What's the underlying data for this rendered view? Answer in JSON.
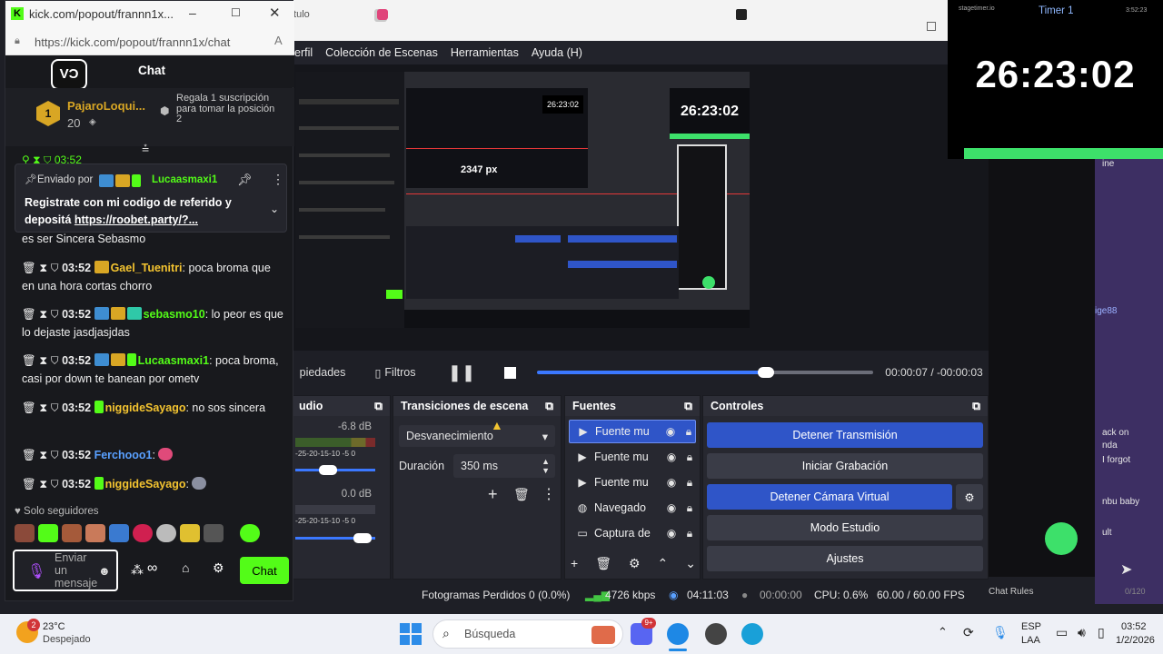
{
  "chat_window": {
    "title": "kick.com/popout/frannn1x...",
    "url": "https://kick.com/popout/frannn1x/chat",
    "header": "Chat",
    "gifter": {
      "rank": "1",
      "name": "PajaroLoqui...",
      "count": "20",
      "text": "Regala 1 suscripción para tomar la posición 2"
    },
    "pinned": {
      "sent_by": "Enviado por",
      "sender": "Lucaasmaxi1",
      "text": "Registrate con mi codigo de referido y depositá ",
      "link": "https://roobet.party/?..."
    },
    "partial_line": "es ser Sincera Sebasmo",
    "messages": [
      {
        "time": "03:52",
        "user": "Gael_Tuenitri",
        "color": "yellow",
        "text": ": poca broma que en una hora cortas chorro"
      },
      {
        "time": "03:52",
        "user": "sebasmo10",
        "color": "green",
        "text": ": lo peor es que lo dejaste jasdjasjdas"
      },
      {
        "time": "03:52",
        "user": "Lucaasmaxi1",
        "color": "green",
        "text": ": poca broma, casi por down te banean por ometv"
      },
      {
        "time": "03:52",
        "user": "niggideSayago",
        "color": "yellow",
        "text": ": no sos sincera"
      },
      {
        "time": "03:52",
        "user": "Ferchooo1",
        "color": "blue",
        "text": ":"
      },
      {
        "time": "03:52",
        "user": "niggideSayago",
        "color": "yellow",
        "text": ":"
      }
    ],
    "followers_only": "Solo seguidores",
    "input_placeholder": "Enviar un mensaje",
    "send_label": "Chat"
  },
  "browser_tab": {
    "title_fragment": "ítulo"
  },
  "obs": {
    "menu": [
      "erfil",
      "Colección de Escenas",
      "Herramientas",
      "Ayuda (H)"
    ],
    "preview_timer": "26:23:02",
    "preview_label": "2347 px",
    "properties_label": "piedades",
    "filters_label": "Filtros",
    "time_elapsed": "00:00:07",
    "time_remaining": "-00:00:03",
    "progress_percent": 63,
    "audio": {
      "title": "udio",
      "levels": [
        "-6.8 dB",
        "0.0 dB"
      ],
      "scale": "-25-20-15-10 -5 0"
    },
    "transitions": {
      "title": "Transiciones de escena",
      "selected": "Desvanecimiento",
      "duration_label": "Duración",
      "duration_value": "350 ms"
    },
    "sources": {
      "title": "Fuentes",
      "items": [
        {
          "label": "Fuente mu",
          "icon": "play-icon"
        },
        {
          "label": "Fuente mu",
          "icon": "play-icon"
        },
        {
          "label": "Fuente mu",
          "icon": "play-icon"
        },
        {
          "label": "Navegado",
          "icon": "globe-icon"
        },
        {
          "label": "Captura de",
          "icon": "monitor-icon"
        }
      ]
    },
    "controls": {
      "title": "Controles",
      "buttons": [
        "Detener Transmisión",
        "Iniciar Grabación",
        "Detener Cámara Virtual",
        "Modo Estudio",
        "Ajustes"
      ]
    },
    "status": {
      "dropped": "Fotogramas Perdidos 0 (0.0%)",
      "bitrate": "4726 kbps",
      "stream_time": "04:11:03",
      "rec_time": "00:00:00",
      "cpu": "CPU: 0.6%",
      "fps": "60.00 / 60.00 FPS"
    }
  },
  "stagetimer": {
    "brand": "stagetimer.io",
    "title": "Timer 1",
    "time_small": "3:52:23",
    "time": "26:23:02"
  },
  "right_panel": {
    "snippets": [
      "ine",
      "ige88",
      "ack on",
      "nda",
      "I forgot",
      "nbu baby",
      "ult",
      "Chat Rules",
      "0/120"
    ]
  },
  "taskbar": {
    "weather_temp": "23°C",
    "weather_desc": "Despejado",
    "weather_badge": "2",
    "search_placeholder": "Búsqueda",
    "lang": "ESP",
    "lang2": "LAA",
    "time": "03:52",
    "date": "1/2/2026",
    "notif_badge": "9+"
  },
  "colors": {
    "accent_blue": "#2f55c8",
    "kick_green": "#53fc18",
    "stagetimer_green": "#3de06a"
  }
}
